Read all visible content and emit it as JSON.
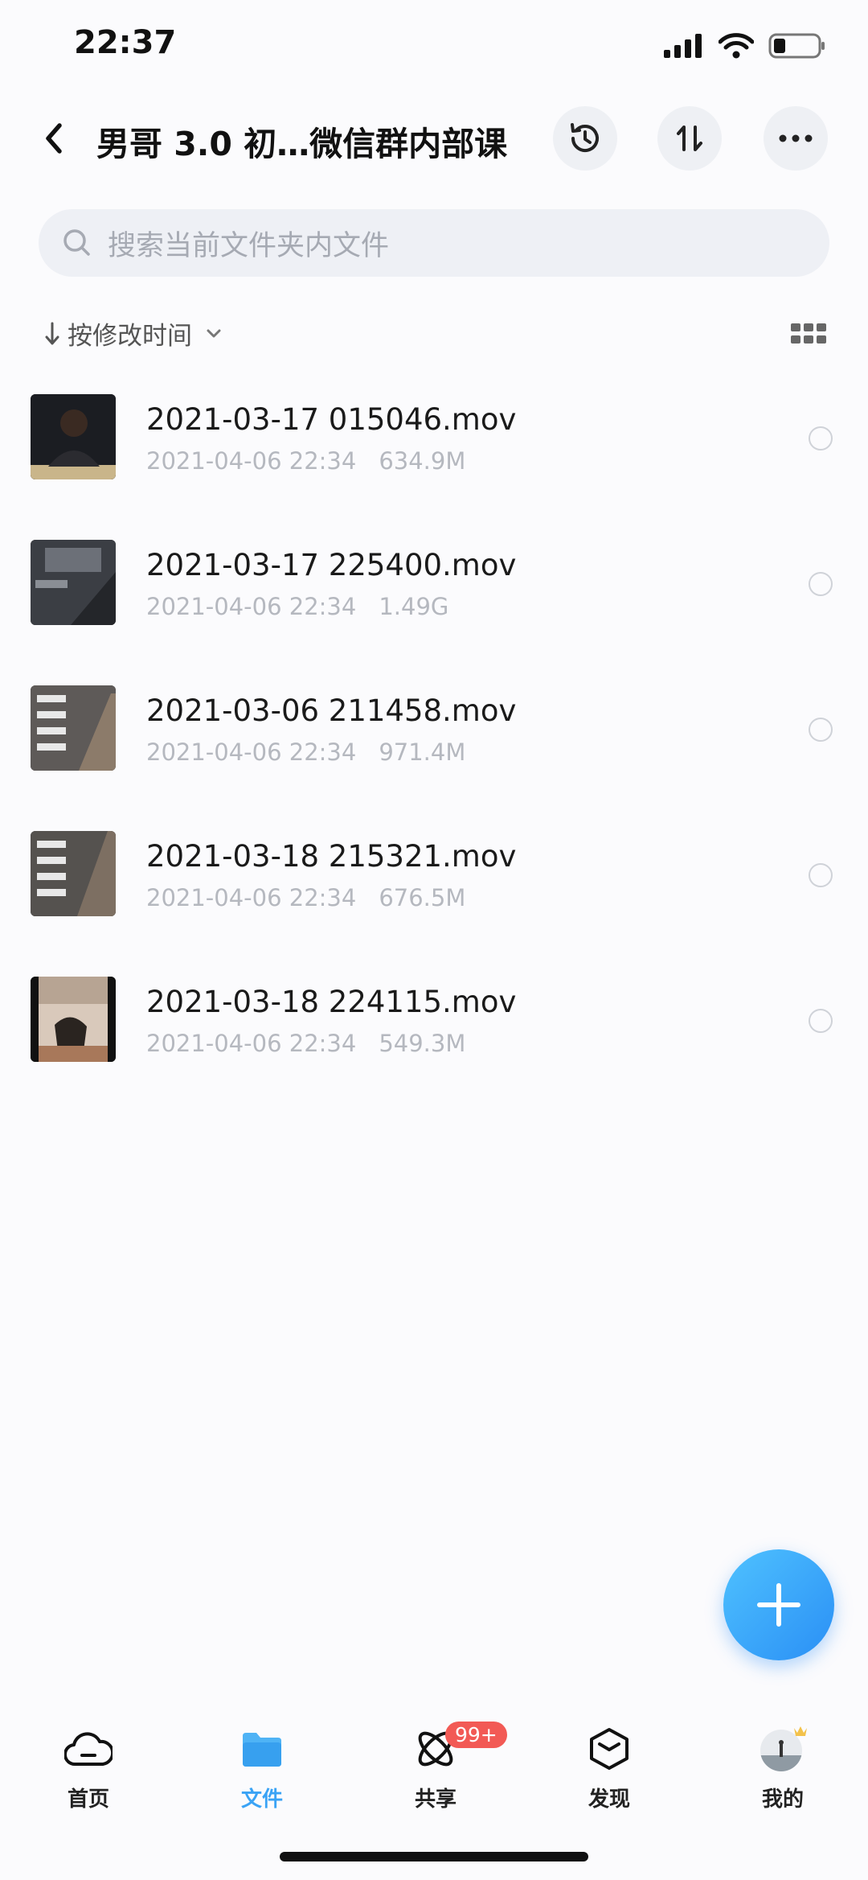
{
  "status_bar": {
    "time": "22:37"
  },
  "nav": {
    "title": "男哥 3.0 初…微信群内部课",
    "icons": [
      "back-icon",
      "history-icon",
      "sort-swap-icon",
      "more-icon"
    ]
  },
  "search": {
    "placeholder": "搜索当前文件夹内文件"
  },
  "sort": {
    "label": "按修改时间"
  },
  "files": [
    {
      "name": "2021-03-17 015046.mov",
      "date": "2021-04-06 22:34",
      "size": "634.9M"
    },
    {
      "name": "2021-03-17 225400.mov",
      "date": "2021-04-06 22:34",
      "size": "1.49G"
    },
    {
      "name": "2021-03-06 211458.mov",
      "date": "2021-04-06 22:34",
      "size": "971.4M"
    },
    {
      "name": "2021-03-18 215321.mov",
      "date": "2021-04-06 22:34",
      "size": "676.5M"
    },
    {
      "name": "2021-03-18 224115.mov",
      "date": "2021-04-06 22:34",
      "size": "549.3M"
    }
  ],
  "tabs": [
    {
      "label": "首页",
      "icon": "cloud-icon"
    },
    {
      "label": "文件",
      "icon": "folder-icon",
      "active": true
    },
    {
      "label": "共享",
      "icon": "orbit-icon",
      "badge": "99+"
    },
    {
      "label": "发现",
      "icon": "cube-icon"
    },
    {
      "label": "我的",
      "icon": "avatar-icon"
    }
  ],
  "colors": {
    "accent": "#3aa3f5",
    "badge": "#f25a55",
    "fab": "#2a8ff5"
  }
}
